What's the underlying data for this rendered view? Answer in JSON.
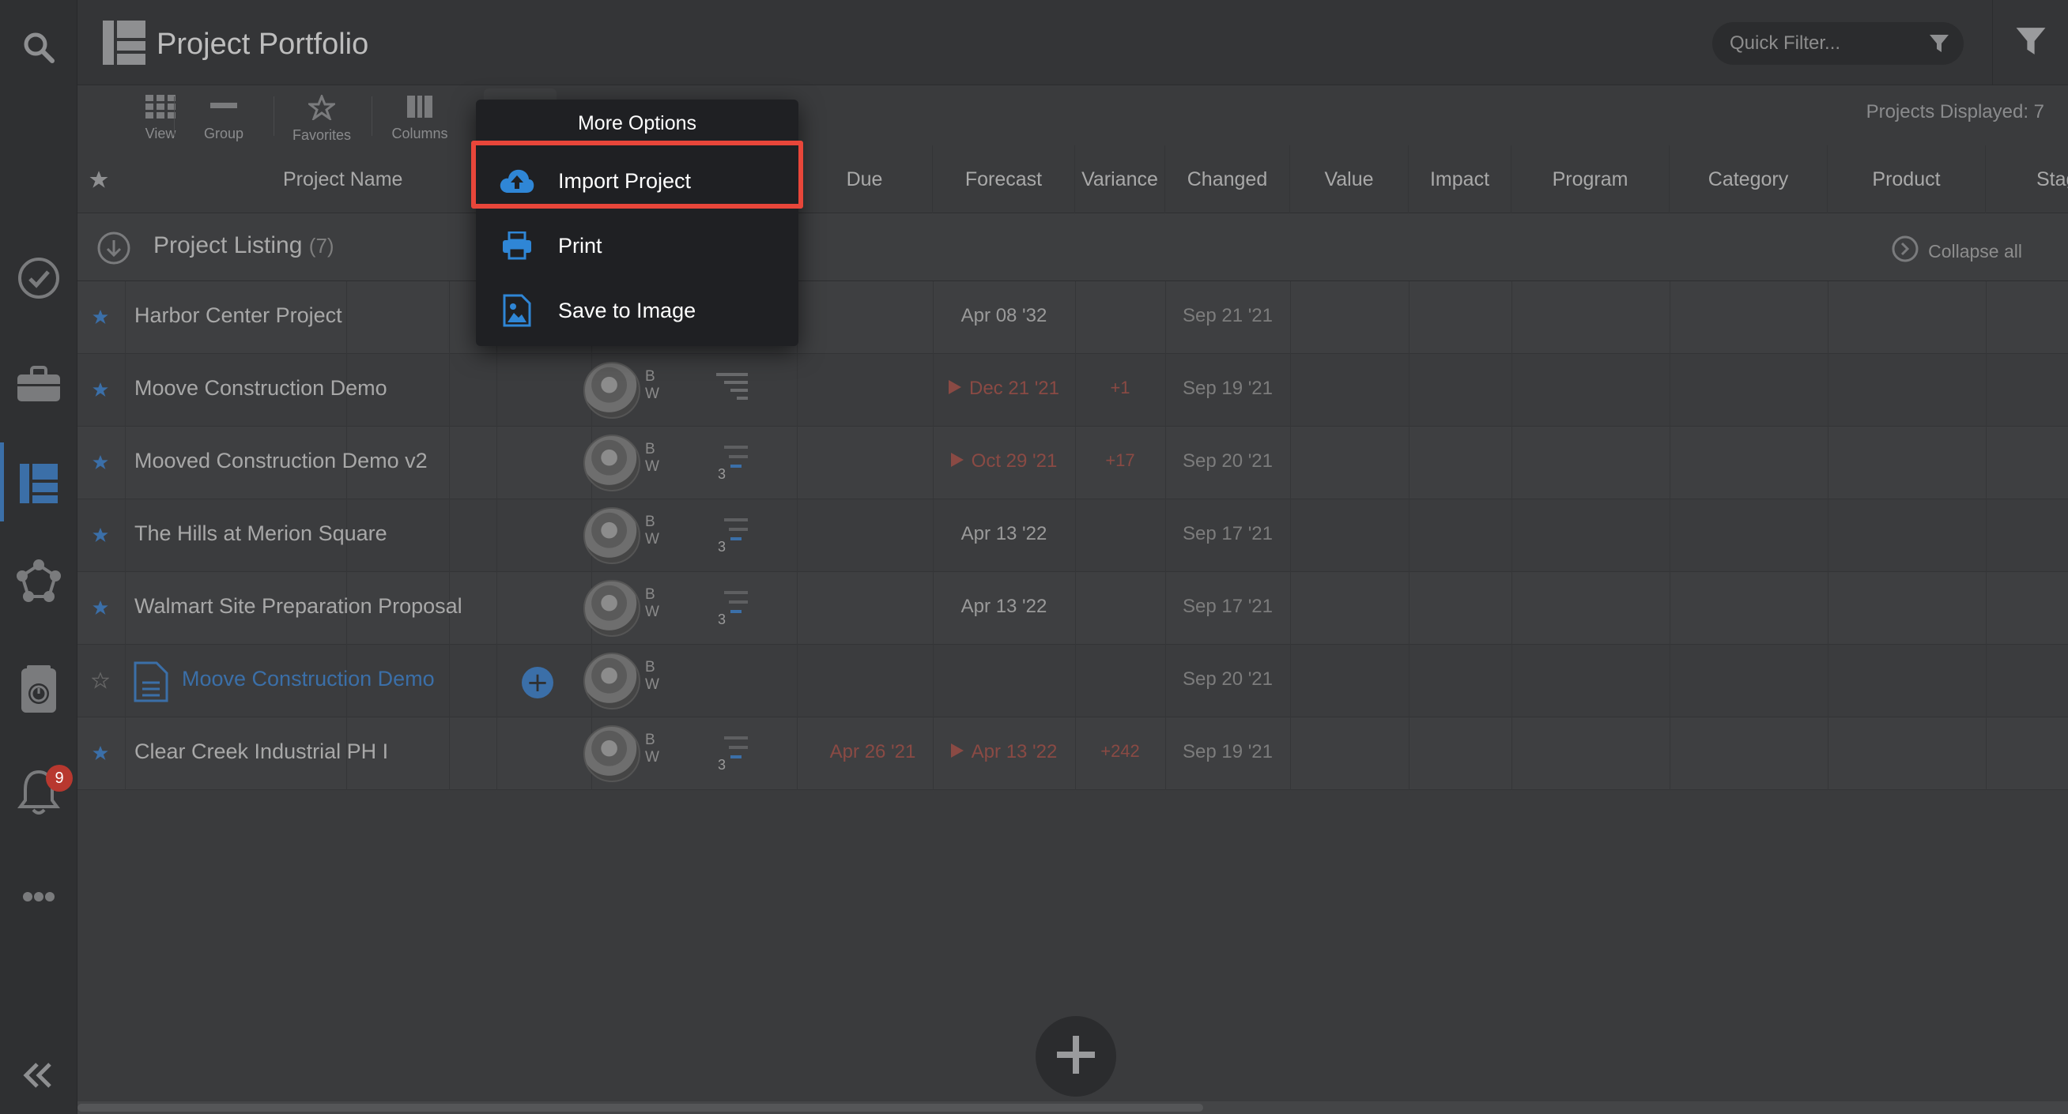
{
  "header": {
    "title": "Project Portfolio",
    "quick_filter_placeholder": "Quick Filter..."
  },
  "toolbar": {
    "tools": [
      "View",
      "Group",
      "Favorites",
      "Columns"
    ],
    "projects_displayed": "Projects Displayed:  7"
  },
  "columns": [
    "Project Name",
    "Due",
    "Forecast",
    "Variance",
    "Changed",
    "Value",
    "Impact",
    "Program",
    "Category",
    "Product",
    "Stag"
  ],
  "group": {
    "title": "Project Listing",
    "count": "(7)",
    "collapse_label": "Collapse all"
  },
  "rows": [
    {
      "name": "Harbor Center Project",
      "initials": [
        "B",
        "W"
      ],
      "due": "",
      "forecast": "Apr 08 '32",
      "forecast_red": false,
      "variance": "",
      "changed": "Sep 21 '21",
      "progress": ""
    },
    {
      "name": "Moove Construction Demo",
      "initials": [
        "B",
        "W"
      ],
      "due": "",
      "forecast": "Dec 21 '21",
      "forecast_red": true,
      "variance": "+1",
      "changed": "Sep 19 '21",
      "progress": ""
    },
    {
      "name": "Mooved Construction Demo v2",
      "initials": [
        "B",
        "W"
      ],
      "due": "",
      "forecast": "Oct 29 '21",
      "forecast_red": true,
      "variance": "+17",
      "changed": "Sep 20 '21",
      "progress": "3"
    },
    {
      "name": "The Hills at Merion Square",
      "initials": [
        "B",
        "W"
      ],
      "due": "",
      "forecast": "Apr 13 '22",
      "forecast_red": false,
      "variance": "",
      "changed": "Sep 17 '21",
      "progress": "3"
    },
    {
      "name": "Walmart Site Preparation Proposal",
      "initials": [
        "B",
        "W"
      ],
      "due": "",
      "forecast": "Apr 13 '22",
      "forecast_red": false,
      "variance": "",
      "changed": "Sep 17 '21",
      "progress": "3"
    },
    {
      "name": "Moove Construction Demo",
      "initials": [
        "B",
        "W"
      ],
      "due": "",
      "forecast": "",
      "forecast_red": false,
      "variance": "",
      "changed": "Sep 20 '21",
      "progress": ""
    },
    {
      "name": "Clear Creek Industrial PH I",
      "initials": [
        "B",
        "W"
      ],
      "due": "Apr 26 '21",
      "forecast": "Apr 13 '22",
      "forecast_red": true,
      "variance": "+242",
      "changed": "Sep 19 '21",
      "progress": "3"
    }
  ],
  "sidebar": {
    "notification_count": "9"
  },
  "menu": {
    "title": "More Options",
    "items": [
      "Import Project",
      "Print",
      "Save to Image"
    ]
  },
  "colors": {
    "accent": "#3b6fa8",
    "highlight": "#e8463a",
    "overdue": "#8a4a44"
  }
}
